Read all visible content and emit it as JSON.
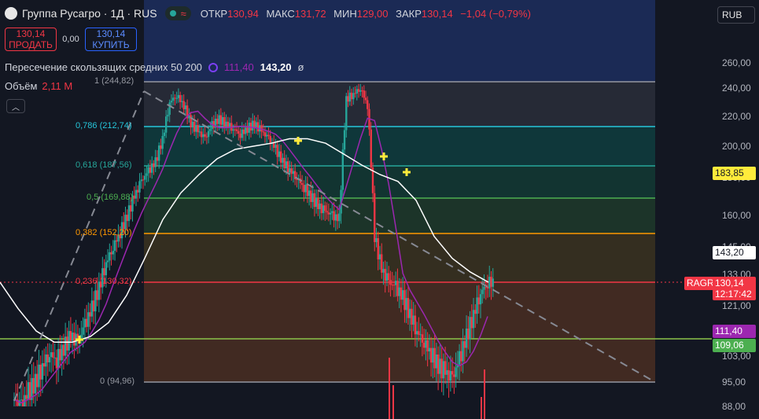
{
  "header": {
    "title": "Группа Русагро · 1Д · RUS",
    "ohlc": [
      {
        "key": "ОТКР",
        "value": "130,94"
      },
      {
        "key": "МАКС",
        "value": "131,72"
      },
      {
        "key": "МИН",
        "value": "129,00"
      },
      {
        "key": "ЗАКР",
        "value": "130,14"
      }
    ],
    "change": "−1,04 (−0,79%)"
  },
  "trade": {
    "sell_price": "130,14",
    "sell_label": "ПРОДАТЬ",
    "spread": "0,00",
    "buy_price": "130,14",
    "buy_label": "КУПИТЬ"
  },
  "indicator": {
    "name": "Пересечение скользящих средних 50 200",
    "ma_fast": "111,40",
    "ma_slow": "143,20",
    "symbol": "ø"
  },
  "volume": {
    "label": "Объём",
    "value": "2,11 M"
  },
  "currency": {
    "selected": "RUB"
  },
  "colors": {
    "up": "#26a69a",
    "down": "#f23645",
    "ma_fast": "#9c27b0",
    "ma_slow": "#ffffff",
    "trend": "#868993"
  },
  "chart_data": {
    "type": "candlestick",
    "y_axis_ticks": [
      "260,00",
      "240,00",
      "220,00",
      "200,00",
      "180,00",
      "160,00",
      "145,00",
      "133,00",
      "121,00",
      "103,00",
      "95,00",
      "88,00"
    ],
    "fib_levels": [
      {
        "ratio": "1",
        "price": "244,82",
        "label": "1 (244,82)",
        "color": "#9598a1"
      },
      {
        "ratio": "0.786",
        "price": "212,74",
        "label": "0,786 (212,74)",
        "color": "#26c6da"
      },
      {
        "ratio": "0.618",
        "price": "187,56",
        "label": "0,618 (187,56)",
        "color": "#26a69a"
      },
      {
        "ratio": "0.5",
        "price": "169,88",
        "label": "0,5 (169,88)",
        "color": "#4caf50"
      },
      {
        "ratio": "0.382",
        "price": "152,20",
        "label": "0,382 (152,20)",
        "color": "#ff9800"
      },
      {
        "ratio": "0.236",
        "price": "130,32",
        "label": "0,236 (130,32)",
        "color": "#f23645"
      },
      {
        "ratio": "0",
        "price": "94,96",
        "label": "0 (94,96)",
        "color": "#9598a1"
      }
    ],
    "horizontal_line": {
      "price": "109,06",
      "color": "#8bc34a"
    },
    "price_badges": [
      {
        "text": "183,85",
        "bg": "#ffeb3b",
        "fg": "#131722"
      },
      {
        "text": "143,20",
        "bg": "#ffffff",
        "fg": "#131722"
      },
      {
        "text": "130,14",
        "bg": "#f23645",
        "fg": "#ffffff",
        "symbol": "RAGR",
        "countdown": "12:17:42"
      },
      {
        "text": "111,40",
        "bg": "#9c27b0",
        "fg": "#ffffff"
      },
      {
        "text": "109,06",
        "bg": "#4caf50",
        "fg": "#ffffff"
      }
    ],
    "series": [
      {
        "values": [
          90,
          88,
          92,
          95,
          100,
          104,
          102,
          106,
          110,
          108,
          114,
          120,
          128,
          138,
          145,
          152,
          160,
          170,
          178,
          184,
          190,
          205,
          230,
          235,
          228,
          215,
          210,
          205,
          214,
          218,
          215,
          212,
          208,
          212,
          215,
          210,
          205,
          198,
          190,
          185,
          180,
          175,
          170,
          165,
          162,
          160,
          158,
          232,
          236,
          240,
          228,
          150,
          135,
          130,
          128,
          124,
          118,
          112,
          108,
          104,
          100,
          98,
          96,
          102,
          110,
          118,
          126,
          130
        ]
      }
    ]
  }
}
